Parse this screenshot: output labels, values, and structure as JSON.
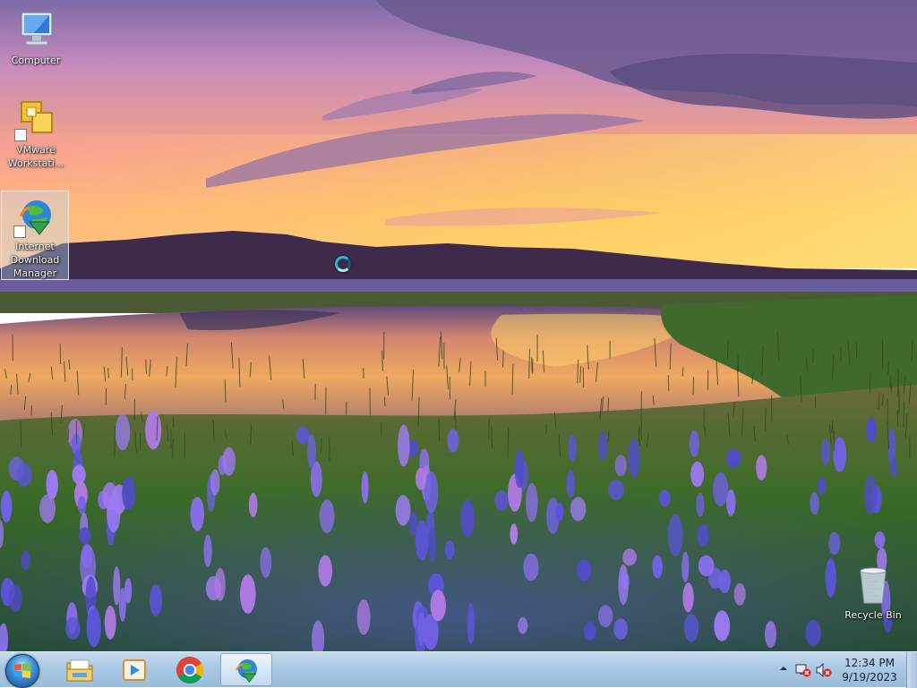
{
  "desktop": {
    "icons": [
      {
        "label": "Computer",
        "icon": "computer-icon",
        "shortcut": false,
        "selected": false
      },
      {
        "label": "VMware\nWorkstati...",
        "icon": "vmware-workstation-icon",
        "shortcut": true,
        "selected": false
      },
      {
        "label": "Internet\nDownload\nManager",
        "icon": "internet-download-manager-icon",
        "shortcut": true,
        "selected": true
      },
      {
        "label": "Recycle Bin",
        "icon": "recycle-bin-icon",
        "shortcut": false,
        "selected": false
      }
    ],
    "cursor": "busy-cursor"
  },
  "taskbar": {
    "start": {
      "icon": "windows-start-orb-icon"
    },
    "pinned": [
      {
        "name": "Windows Explorer",
        "icon": "folder-explorer-icon",
        "active": false
      },
      {
        "name": "Windows Media Player",
        "icon": "media-player-icon",
        "active": false
      },
      {
        "name": "Google Chrome",
        "icon": "chrome-icon",
        "active": false
      },
      {
        "name": "Internet Download Manager",
        "icon": "internet-download-manager-icon",
        "active": true
      }
    ],
    "tray": {
      "icons": [
        "show-hidden-icons-chevron-icon",
        "network-disconnected-icon",
        "volume-muted-icon"
      ],
      "time": "12:34 PM",
      "date": "9/19/2023"
    }
  },
  "colors": {
    "taskbar": "#a9c8e3",
    "selection": "#bedcff",
    "sky_top": "#7a6aa6",
    "sunset": "#ffc65a",
    "flowers": "#6a5ee0"
  }
}
